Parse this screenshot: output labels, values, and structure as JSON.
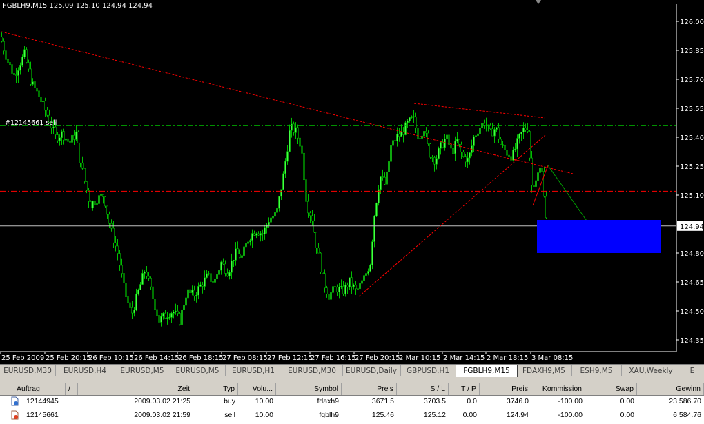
{
  "chart": {
    "symbol_info": "FGBLH9,M15  125.09 125.10 124.94 124.94",
    "order_label": "#12145661 sell",
    "current_price_label": "124.94",
    "price_ticks": [
      "126.00",
      "125.85",
      "125.70",
      "125.55",
      "125.40",
      "125.25",
      "125.10",
      "124.80",
      "124.65",
      "124.50",
      "124.35"
    ],
    "time_ticks": [
      "25 Feb 2009",
      "25 Feb 20:15",
      "26 Feb 10:15",
      "26 Feb 14:15",
      "26 Feb 18:15",
      "27 Feb 08:15",
      "27 Feb 12:15",
      "27 Feb 16:15",
      "27 Feb 20:15",
      "2 Mar 10:15",
      "2 Mar 14:15",
      "2 Mar 18:15",
      "3 Mar 08:15"
    ],
    "colors": {
      "candle": "#00c000",
      "candle_fill": "#44ff44",
      "bg": "#000000",
      "grid_text": "#ffffff",
      "trend": "#ff0000",
      "order_line": "#00c000",
      "sl_line": "#ff0000",
      "bid_line": "#c0c0c0",
      "box": "#0000ff"
    }
  },
  "tabs": [
    {
      "label": "EURUSD,M30"
    },
    {
      "label": "EURUSD,H4"
    },
    {
      "label": "EURUSD,M5"
    },
    {
      "label": "EURUSD,M5"
    },
    {
      "label": "EURUSD,H1"
    },
    {
      "label": "EURUSD,M30"
    },
    {
      "label": "EURUSD,Daily"
    },
    {
      "label": "GBPUSD,H1"
    },
    {
      "label": "FGBLH9,M15"
    },
    {
      "label": "FDAXH9,M5"
    },
    {
      "label": "ESH9,M5"
    },
    {
      "label": "XAU,Weekly"
    },
    {
      "label": "E"
    }
  ],
  "table": {
    "headers": {
      "order": "Auftrag",
      "sort": "/",
      "time": "Zeit",
      "type": "Typ",
      "volume": "Volu...",
      "symbol": "Symbol",
      "price": "Preis",
      "sl": "S / L",
      "tp": "T / P",
      "cur_price": "Preis",
      "commission": "Kommission",
      "swap": "Swap",
      "profit": "Gewinn"
    },
    "rows": [
      {
        "order": "12144945",
        "time": "2009.03.02 21:25",
        "type": "buy",
        "volume": "10.00",
        "symbol": "fdaxh9",
        "price": "3671.5",
        "sl": "3703.5",
        "tp": "0.0",
        "cur_price": "3746.0",
        "commission": "-100.00",
        "swap": "0.00",
        "profit": "23 586.70"
      },
      {
        "order": "12145661",
        "time": "2009.03.02 21:59",
        "type": "sell",
        "volume": "10.00",
        "symbol": "fgblh9",
        "price": "125.46",
        "sl": "125.12",
        "tp": "0.00",
        "cur_price": "124.94",
        "commission": "-100.00",
        "swap": "0.00",
        "profit": "6 584.76"
      }
    ]
  }
}
